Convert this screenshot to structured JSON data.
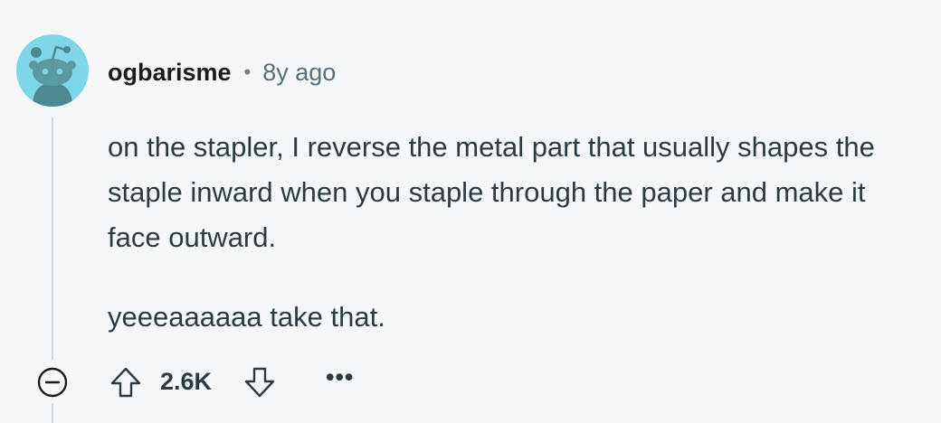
{
  "comment": {
    "author": "ogbarisme",
    "separator": "•",
    "time_ago": "8y ago",
    "paragraphs": [
      "on the stapler, I reverse the metal part that usually shapes the staple inward when you staple through the paper and make it face outward.",
      "yeeeaaaaaa take that."
    ],
    "score": "2.6K",
    "more_label": "•••"
  },
  "icons": {
    "avatar": "snoo-avatar-icon",
    "collapse": "collapse-minus-icon",
    "upvote": "upvote-arrow-icon",
    "downvote": "downvote-arrow-icon",
    "more": "more-options-icon"
  },
  "colors": {
    "background": "#f6f7f8",
    "avatar_bg": "#7fd6e8",
    "thread_line": "#c9dbe3",
    "text": "#2a3c42",
    "meta": "#576f76"
  }
}
